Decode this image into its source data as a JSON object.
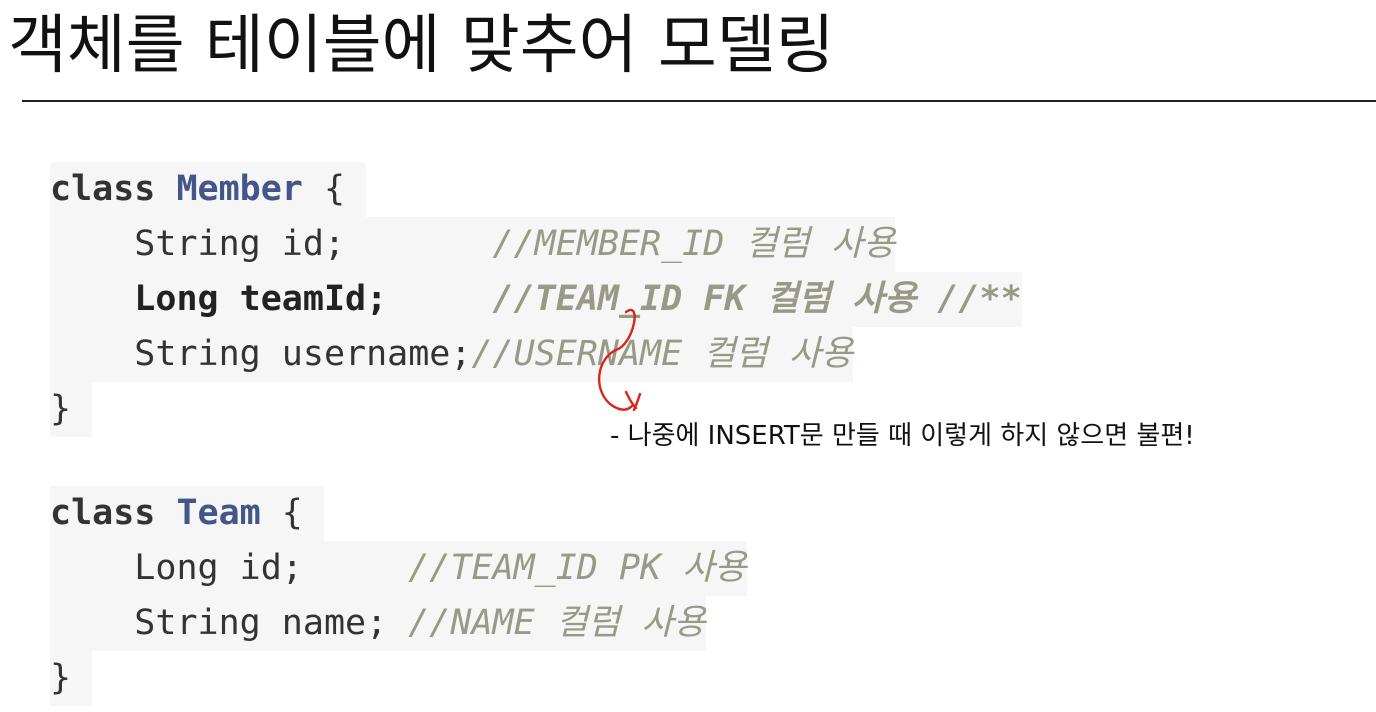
{
  "slide": {
    "title": "객체를 테이블에 맞추어 모델링"
  },
  "code": {
    "member": {
      "class_keyword": "class",
      "class_name": "Member",
      "open_brace": " {",
      "indent": "    ",
      "lines": [
        {
          "code": "String id;       ",
          "comment": "//MEMBER_ID 컬럼 사용",
          "bold": false
        },
        {
          "code": "Long teamId;     ",
          "comment": "//TEAM_ID FK 컬럼 사용 //**",
          "bold": true
        },
        {
          "code": "String username;",
          "comment": "//USERNAME 컬럼 사용",
          "bold": false
        }
      ],
      "close_brace": "}"
    },
    "team": {
      "class_keyword": "class",
      "class_name": "Team",
      "open_brace": " {",
      "indent": "    ",
      "lines": [
        {
          "code": "Long id;     ",
          "comment": "//TEAM_ID PK 사용",
          "bold": false
        },
        {
          "code": "String name; ",
          "comment": "//NAME 컬럼 사용",
          "bold": false
        }
      ],
      "close_brace": "}"
    }
  },
  "annotation": {
    "note": "- 나중에 INSERT문 만들 때 이렇게 하지 않으면 불편!",
    "stroke_color": "#d9251c"
  },
  "colors": {
    "code_background": "#f6f6f6",
    "class_name": "#445588",
    "comment": "#999988",
    "text": "#333333"
  }
}
